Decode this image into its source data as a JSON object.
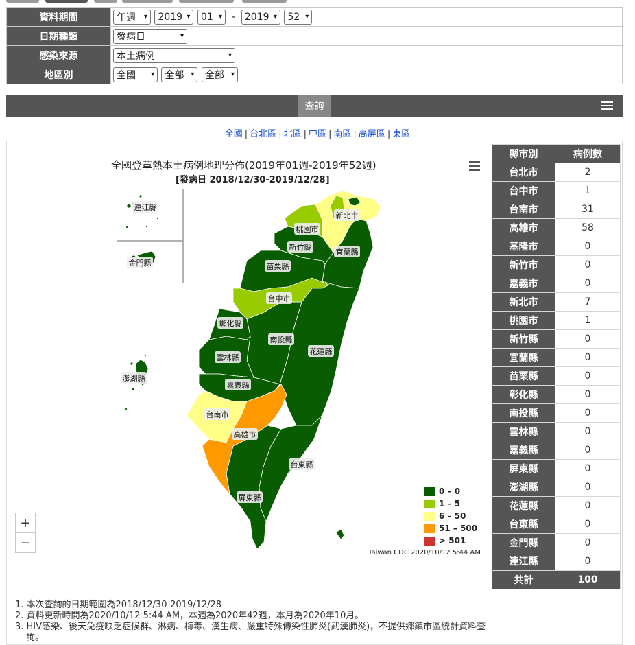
{
  "form": {
    "period_label": "資料期間",
    "period_type": "年週",
    "start_year": "2019",
    "start_week": "01",
    "range_sep": "-",
    "end_year": "2019",
    "end_week": "52",
    "date_type_label": "日期種類",
    "date_type": "發病日",
    "source_label": "感染來源",
    "source": "本土病例",
    "region_label": "地區別",
    "region": "全國",
    "region_sub1": "全部",
    "region_sub2": "全部",
    "query_button": "查詢"
  },
  "regions": [
    "全國",
    "台北區",
    "北區",
    "中區",
    "南區",
    "高屏區",
    "東區"
  ],
  "map": {
    "title": "全國登革熱本土病例地理分佈(2019年01週-2019年52週)",
    "subtitle": "[發病日 2018/12/30-2019/12/28]",
    "credit": "Taiwan CDC 2020/10/12 5:44 AM",
    "zoom_in": "+",
    "zoom_out": "−",
    "colors": {
      "c0": "#0a5c00",
      "c1": "#99cc00",
      "c2": "#ffff88",
      "c3": "#ff9900",
      "c4": "#cc3333"
    },
    "labels": {
      "lienchiang": "連江縣",
      "kinmen": "金門縣",
      "newtaipei": "新北市",
      "taoyuan": "桃園市",
      "hsinchu": "新竹縣",
      "yilan": "宜蘭縣",
      "miaoli": "苗栗縣",
      "taichung": "台中市",
      "changhua": "彰化縣",
      "nantou": "南投縣",
      "hualien": "花蓮縣",
      "yunlin": "雲林縣",
      "penghu": "澎湖縣",
      "chiayi": "嘉義縣",
      "tainan": "台南市",
      "kaohsiung": "高雄市",
      "taitung": "台東縣",
      "pingtung": "屏東縣"
    }
  },
  "legend": [
    {
      "label": "0 – 0",
      "color": "#0a5c00"
    },
    {
      "label": "1 – 5",
      "color": "#99cc00"
    },
    {
      "label": "6 – 50",
      "color": "#ffff88"
    },
    {
      "label": "51 – 500",
      "color": "#ff9900"
    },
    {
      "label": "> 501",
      "color": "#cc3333"
    }
  ],
  "table": {
    "headers": [
      "縣市別",
      "病例數"
    ],
    "rows": [
      [
        "台北市",
        "2"
      ],
      [
        "台中市",
        "1"
      ],
      [
        "台南市",
        "31"
      ],
      [
        "高雄市",
        "58"
      ],
      [
        "基隆市",
        "0"
      ],
      [
        "新竹市",
        "0"
      ],
      [
        "嘉義市",
        "0"
      ],
      [
        "新北市",
        "7"
      ],
      [
        "桃園市",
        "1"
      ],
      [
        "新竹縣",
        "0"
      ],
      [
        "宜蘭縣",
        "0"
      ],
      [
        "苗栗縣",
        "0"
      ],
      [
        "彰化縣",
        "0"
      ],
      [
        "南投縣",
        "0"
      ],
      [
        "雲林縣",
        "0"
      ],
      [
        "嘉義縣",
        "0"
      ],
      [
        "屏東縣",
        "0"
      ],
      [
        "澎湖縣",
        "0"
      ],
      [
        "花蓮縣",
        "0"
      ],
      [
        "台東縣",
        "0"
      ],
      [
        "金門縣",
        "0"
      ],
      [
        "連江縣",
        "0"
      ]
    ],
    "total_label": "共計",
    "total_value": "100"
  },
  "notes": [
    "1. 本次查詢的日期範圍為2018/12/30-2019/12/28",
    "2. 資料更新時間為2020/10/12 5:44 AM，本週為2020年42週，本月為2020年10月。",
    "3. HIV感染、後天免疫缺乏症候群、淋病、梅毒、漢生病、嚴重特殊傳染性肺炎(武漢肺炎)，不提供鄉鎮市區統計資料查詢。"
  ]
}
